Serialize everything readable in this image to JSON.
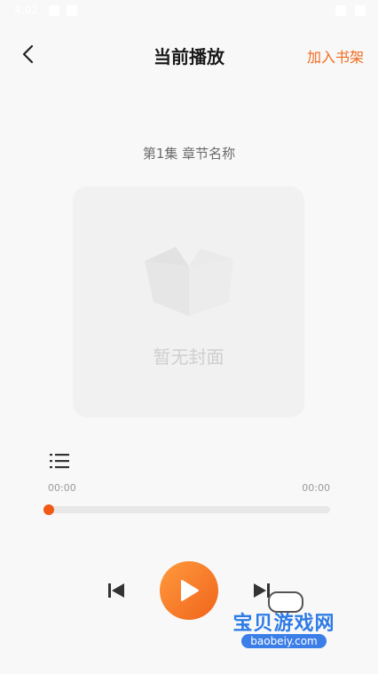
{
  "status": {
    "time": "4:02"
  },
  "nav": {
    "title": "当前播放",
    "action": "加入书架"
  },
  "chapter": {
    "title": "第1集 章节名称"
  },
  "cover": {
    "placeholder": "暂无封面"
  },
  "player": {
    "current_time": "00:00",
    "total_time": "00:00",
    "progress": 0.0
  },
  "watermark": {
    "text": "宝贝游戏网",
    "url": "baobeiy.com"
  },
  "colors": {
    "accent": "#f26b1d",
    "background": "#f8f8f8"
  }
}
